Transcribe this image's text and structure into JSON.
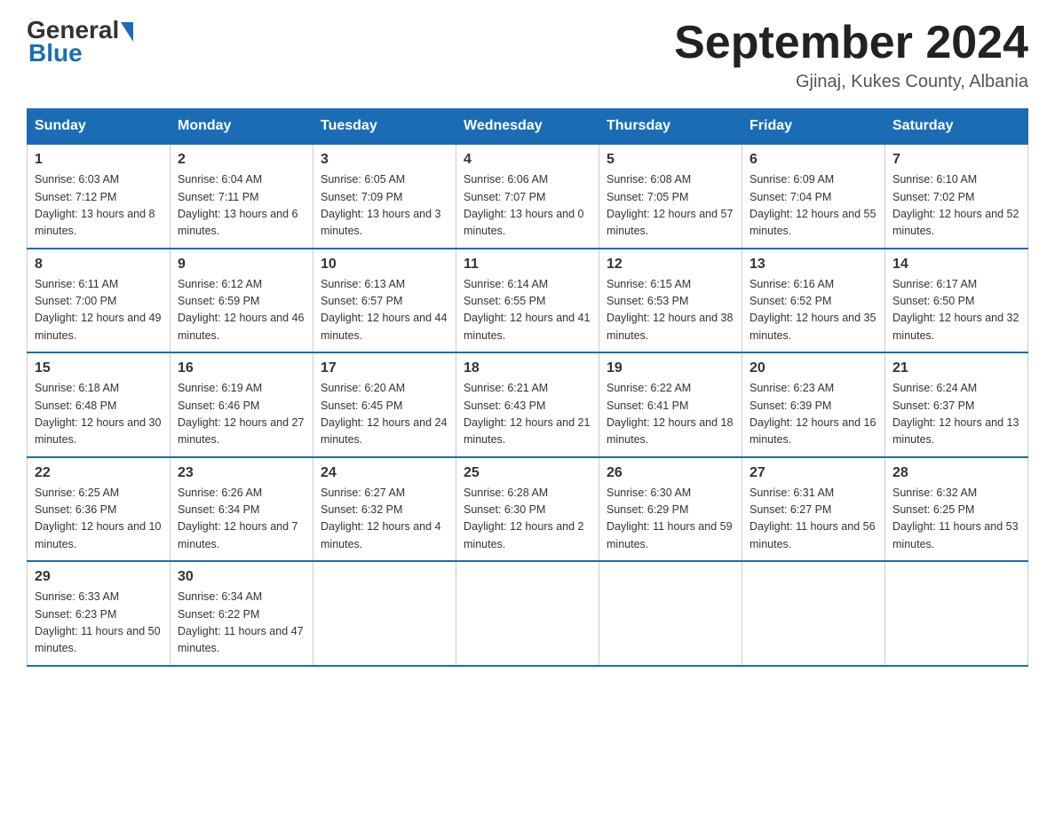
{
  "header": {
    "logo_text_general": "General",
    "logo_text_blue": "Blue",
    "month_title": "September 2024",
    "location": "Gjinaj, Kukes County, Albania"
  },
  "days_of_week": [
    "Sunday",
    "Monday",
    "Tuesday",
    "Wednesday",
    "Thursday",
    "Friday",
    "Saturday"
  ],
  "weeks": [
    [
      {
        "day": "1",
        "sunrise": "6:03 AM",
        "sunset": "7:12 PM",
        "daylight": "13 hours and 8 minutes."
      },
      {
        "day": "2",
        "sunrise": "6:04 AM",
        "sunset": "7:11 PM",
        "daylight": "13 hours and 6 minutes."
      },
      {
        "day": "3",
        "sunrise": "6:05 AM",
        "sunset": "7:09 PM",
        "daylight": "13 hours and 3 minutes."
      },
      {
        "day": "4",
        "sunrise": "6:06 AM",
        "sunset": "7:07 PM",
        "daylight": "13 hours and 0 minutes."
      },
      {
        "day": "5",
        "sunrise": "6:08 AM",
        "sunset": "7:05 PM",
        "daylight": "12 hours and 57 minutes."
      },
      {
        "day": "6",
        "sunrise": "6:09 AM",
        "sunset": "7:04 PM",
        "daylight": "12 hours and 55 minutes."
      },
      {
        "day": "7",
        "sunrise": "6:10 AM",
        "sunset": "7:02 PM",
        "daylight": "12 hours and 52 minutes."
      }
    ],
    [
      {
        "day": "8",
        "sunrise": "6:11 AM",
        "sunset": "7:00 PM",
        "daylight": "12 hours and 49 minutes."
      },
      {
        "day": "9",
        "sunrise": "6:12 AM",
        "sunset": "6:59 PM",
        "daylight": "12 hours and 46 minutes."
      },
      {
        "day": "10",
        "sunrise": "6:13 AM",
        "sunset": "6:57 PM",
        "daylight": "12 hours and 44 minutes."
      },
      {
        "day": "11",
        "sunrise": "6:14 AM",
        "sunset": "6:55 PM",
        "daylight": "12 hours and 41 minutes."
      },
      {
        "day": "12",
        "sunrise": "6:15 AM",
        "sunset": "6:53 PM",
        "daylight": "12 hours and 38 minutes."
      },
      {
        "day": "13",
        "sunrise": "6:16 AM",
        "sunset": "6:52 PM",
        "daylight": "12 hours and 35 minutes."
      },
      {
        "day": "14",
        "sunrise": "6:17 AM",
        "sunset": "6:50 PM",
        "daylight": "12 hours and 32 minutes."
      }
    ],
    [
      {
        "day": "15",
        "sunrise": "6:18 AM",
        "sunset": "6:48 PM",
        "daylight": "12 hours and 30 minutes."
      },
      {
        "day": "16",
        "sunrise": "6:19 AM",
        "sunset": "6:46 PM",
        "daylight": "12 hours and 27 minutes."
      },
      {
        "day": "17",
        "sunrise": "6:20 AM",
        "sunset": "6:45 PM",
        "daylight": "12 hours and 24 minutes."
      },
      {
        "day": "18",
        "sunrise": "6:21 AM",
        "sunset": "6:43 PM",
        "daylight": "12 hours and 21 minutes."
      },
      {
        "day": "19",
        "sunrise": "6:22 AM",
        "sunset": "6:41 PM",
        "daylight": "12 hours and 18 minutes."
      },
      {
        "day": "20",
        "sunrise": "6:23 AM",
        "sunset": "6:39 PM",
        "daylight": "12 hours and 16 minutes."
      },
      {
        "day": "21",
        "sunrise": "6:24 AM",
        "sunset": "6:37 PM",
        "daylight": "12 hours and 13 minutes."
      }
    ],
    [
      {
        "day": "22",
        "sunrise": "6:25 AM",
        "sunset": "6:36 PM",
        "daylight": "12 hours and 10 minutes."
      },
      {
        "day": "23",
        "sunrise": "6:26 AM",
        "sunset": "6:34 PM",
        "daylight": "12 hours and 7 minutes."
      },
      {
        "day": "24",
        "sunrise": "6:27 AM",
        "sunset": "6:32 PM",
        "daylight": "12 hours and 4 minutes."
      },
      {
        "day": "25",
        "sunrise": "6:28 AM",
        "sunset": "6:30 PM",
        "daylight": "12 hours and 2 minutes."
      },
      {
        "day": "26",
        "sunrise": "6:30 AM",
        "sunset": "6:29 PM",
        "daylight": "11 hours and 59 minutes."
      },
      {
        "day": "27",
        "sunrise": "6:31 AM",
        "sunset": "6:27 PM",
        "daylight": "11 hours and 56 minutes."
      },
      {
        "day": "28",
        "sunrise": "6:32 AM",
        "sunset": "6:25 PM",
        "daylight": "11 hours and 53 minutes."
      }
    ],
    [
      {
        "day": "29",
        "sunrise": "6:33 AM",
        "sunset": "6:23 PM",
        "daylight": "11 hours and 50 minutes."
      },
      {
        "day": "30",
        "sunrise": "6:34 AM",
        "sunset": "6:22 PM",
        "daylight": "11 hours and 47 minutes."
      },
      null,
      null,
      null,
      null,
      null
    ]
  ]
}
